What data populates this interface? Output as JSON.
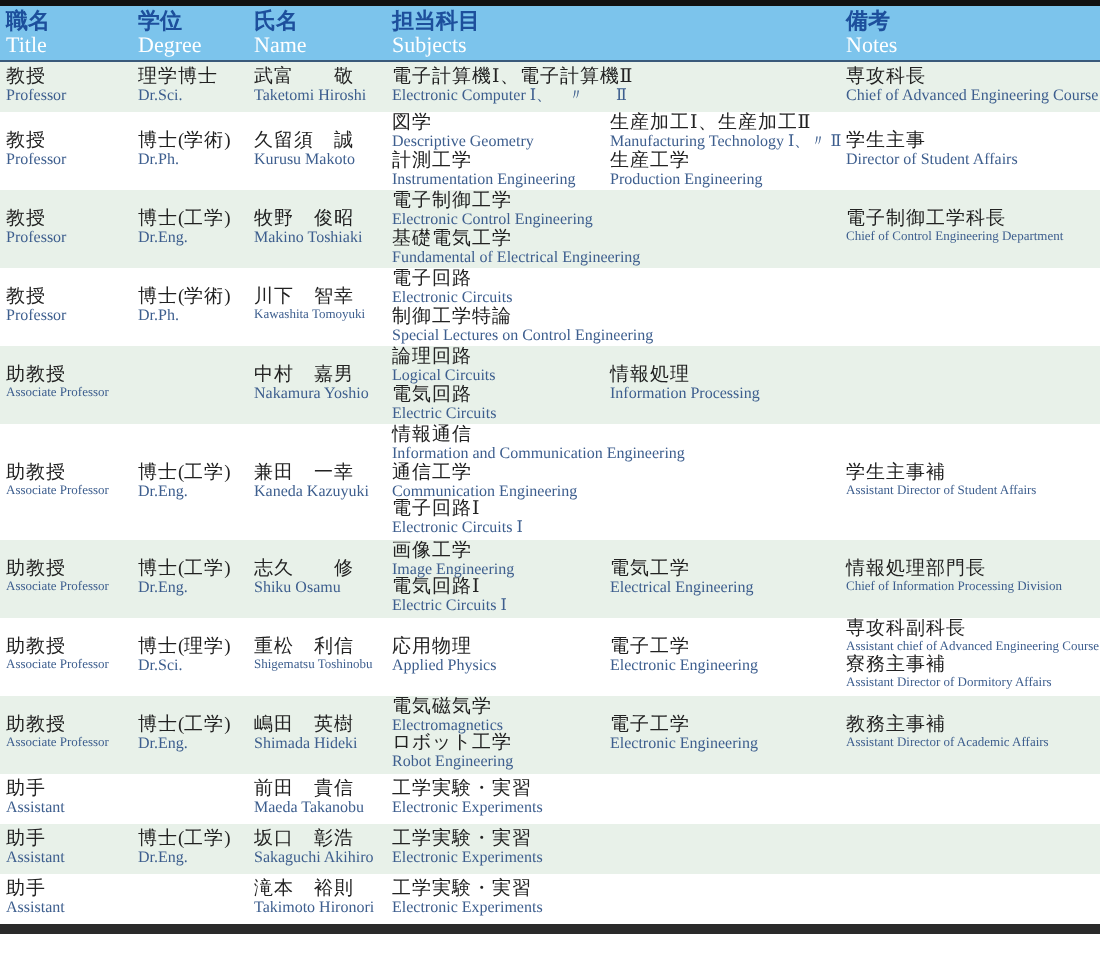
{
  "header": [
    {
      "jp": "職名",
      "en": "Title"
    },
    {
      "jp": "学位",
      "en": "Degree"
    },
    {
      "jp": "氏名",
      "en": "Name"
    },
    {
      "jp": "担当科目",
      "en": "Subjects"
    },
    {
      "jp": "備考",
      "en": "Notes"
    }
  ],
  "rows": [
    {
      "title": {
        "jp": "教授",
        "en": "Professor"
      },
      "degree": {
        "jp": "理学博士",
        "en": "Dr.Sci."
      },
      "name": {
        "jp": "武富　　敬",
        "en": "Taketomi Hiroshi"
      },
      "subjects": [
        [
          {
            "jp": "電子計算機Ⅰ、電子計算機Ⅱ",
            "en": "Electronic Computer Ⅰ、　〃　　Ⅱ"
          }
        ]
      ],
      "notes": [
        {
          "jp": "専攻科長",
          "en": "Chief of Advanced Engineering Course"
        }
      ]
    },
    {
      "title": {
        "jp": "教授",
        "en": "Professor"
      },
      "degree": {
        "jp": "博士(学術)",
        "en": "Dr.Ph."
      },
      "name": {
        "jp": "久留須　誠",
        "en": "Kurusu Makoto"
      },
      "subjects": [
        [
          {
            "jp": "図学",
            "en": "Descriptive Geometry"
          },
          {
            "jp": "計測工学",
            "en": "Instrumentation Engineering"
          }
        ],
        [
          {
            "jp": "生産加工Ⅰ、生産加工Ⅱ",
            "en": "Manufacturing Technology Ⅰ、〃 Ⅱ"
          },
          {
            "jp": "生産工学",
            "en": "Production Engineering"
          }
        ]
      ],
      "notes": [
        {
          "jp": "学生主事",
          "en": "Director of Student Affairs"
        }
      ]
    },
    {
      "title": {
        "jp": "教授",
        "en": "Professor"
      },
      "degree": {
        "jp": "博士(工学)",
        "en": "Dr.Eng."
      },
      "name": {
        "jp": "牧野　俊昭",
        "en": "Makino Toshiaki"
      },
      "subjects": [
        [
          {
            "jp": "電子制御工学",
            "en": "Electronic Control Engineering"
          },
          {
            "jp": "基礎電気工学",
            "en": "Fundamental of Electrical Engineering"
          }
        ]
      ],
      "notes": [
        {
          "jp": "電子制御工学科長",
          "en": "Chief of Control Engineering Department"
        }
      ]
    },
    {
      "title": {
        "jp": "教授",
        "en": "Professor"
      },
      "degree": {
        "jp": "博士(学術)",
        "en": "Dr.Ph."
      },
      "name": {
        "jp": "川下　智幸",
        "en": "Kawashita Tomoyuki"
      },
      "subjects": [
        [
          {
            "jp": "電子回路",
            "en": "Electronic Circuits"
          },
          {
            "jp": "制御工学特論",
            "en": "Special Lectures on Control Engineering"
          }
        ]
      ],
      "notes": []
    },
    {
      "title": {
        "jp": "助教授",
        "en": "Associate Professor"
      },
      "name": {
        "jp": "中村　嘉男",
        "en": "Nakamura Yoshio"
      },
      "subjects": [
        [
          {
            "jp": "論理回路",
            "en": "Logical Circuits"
          },
          {
            "jp": "電気回路",
            "en": "Electric Circuits"
          }
        ],
        [
          {
            "jp": "情報処理",
            "en": "Information Processing"
          }
        ]
      ],
      "notes": []
    },
    {
      "title": {
        "jp": "助教授",
        "en": "Associate Professor"
      },
      "degree": {
        "jp": "博士(工学)",
        "en": "Dr.Eng."
      },
      "name": {
        "jp": "兼田　一幸",
        "en": "Kaneda Kazuyuki"
      },
      "subjects": [
        [
          {
            "jp": "情報通信",
            "en": "Information and Communication Engineering"
          },
          {
            "jp": "通信工学",
            "en": "Communication Engineering"
          },
          {
            "jp": "電子回路Ⅰ",
            "en": "Electronic Circuits Ⅰ"
          }
        ]
      ],
      "notes": [
        {
          "jp": "学生主事補",
          "en": "Assistant Director of Student Affairs"
        }
      ]
    },
    {
      "title": {
        "jp": "助教授",
        "en": "Associate Professor"
      },
      "degree": {
        "jp": "博士(工学)",
        "en": "Dr.Eng."
      },
      "name": {
        "jp": "志久　　修",
        "en": "Shiku Osamu"
      },
      "subjects": [
        [
          {
            "jp": "画像工学",
            "en": "Image Engineering"
          },
          {
            "jp": "電気回路Ⅰ",
            "en": "Electric Circuits Ⅰ"
          }
        ],
        [
          {
            "jp": "電気工学",
            "en": "Electrical Engineering"
          }
        ]
      ],
      "notes": [
        {
          "jp": "情報処理部門長",
          "en": "Chief of Information Processing Division"
        }
      ]
    },
    {
      "title": {
        "jp": "助教授",
        "en": "Associate Professor"
      },
      "degree": {
        "jp": "博士(理学)",
        "en": "Dr.Sci."
      },
      "name": {
        "jp": "重松　利信",
        "en": "Shigematsu Toshinobu"
      },
      "subjects": [
        [
          {
            "jp": "応用物理",
            "en": "Applied Physics"
          }
        ],
        [
          {
            "jp": "電子工学",
            "en": "Electronic Engineering"
          }
        ]
      ],
      "notes": [
        {
          "jp": "専攻科副科長",
          "en": "Assistant chief of Advanced Engineering Course"
        },
        {
          "jp": "寮務主事補",
          "en": "Assistant Director of Dormitory Affairs"
        }
      ]
    },
    {
      "title": {
        "jp": "助教授",
        "en": "Associate Professor"
      },
      "degree": {
        "jp": "博士(工学)",
        "en": "Dr.Eng."
      },
      "name": {
        "jp": "嶋田　英樹",
        "en": "Shimada Hideki"
      },
      "subjects": [
        [
          {
            "jp": "電気磁気学",
            "en": "Electromagnetics"
          },
          {
            "jp": "ロボット工学",
            "en": "Robot Engineering"
          }
        ],
        [
          {
            "jp": "電子工学",
            "en": "Electronic Engineering"
          }
        ]
      ],
      "notes": [
        {
          "jp": "教務主事補",
          "en": "Assistant Director of Academic Affairs"
        }
      ]
    },
    {
      "title": {
        "jp": "助手",
        "en": "Assistant"
      },
      "name": {
        "jp": "前田　貴信",
        "en": "Maeda Takanobu"
      },
      "subjects": [
        [
          {
            "jp": "工学実験・実習",
            "en": "Electronic Experiments"
          }
        ]
      ],
      "notes": []
    },
    {
      "title": {
        "jp": "助手",
        "en": "Assistant"
      },
      "degree": {
        "jp": "博士(工学)",
        "en": "Dr.Eng."
      },
      "name": {
        "jp": "坂口　彰浩",
        "en": "Sakaguchi Akihiro"
      },
      "subjects": [
        [
          {
            "jp": "工学実験・実習",
            "en": "Electronic Experiments"
          }
        ]
      ],
      "notes": []
    },
    {
      "title": {
        "jp": "助手",
        "en": "Assistant"
      },
      "name": {
        "jp": "滝本　裕則",
        "en": "Takimoto Hironori"
      },
      "subjects": [
        [
          {
            "jp": "工学実験・実習",
            "en": "Electronic Experiments"
          }
        ]
      ],
      "notes": []
    }
  ]
}
